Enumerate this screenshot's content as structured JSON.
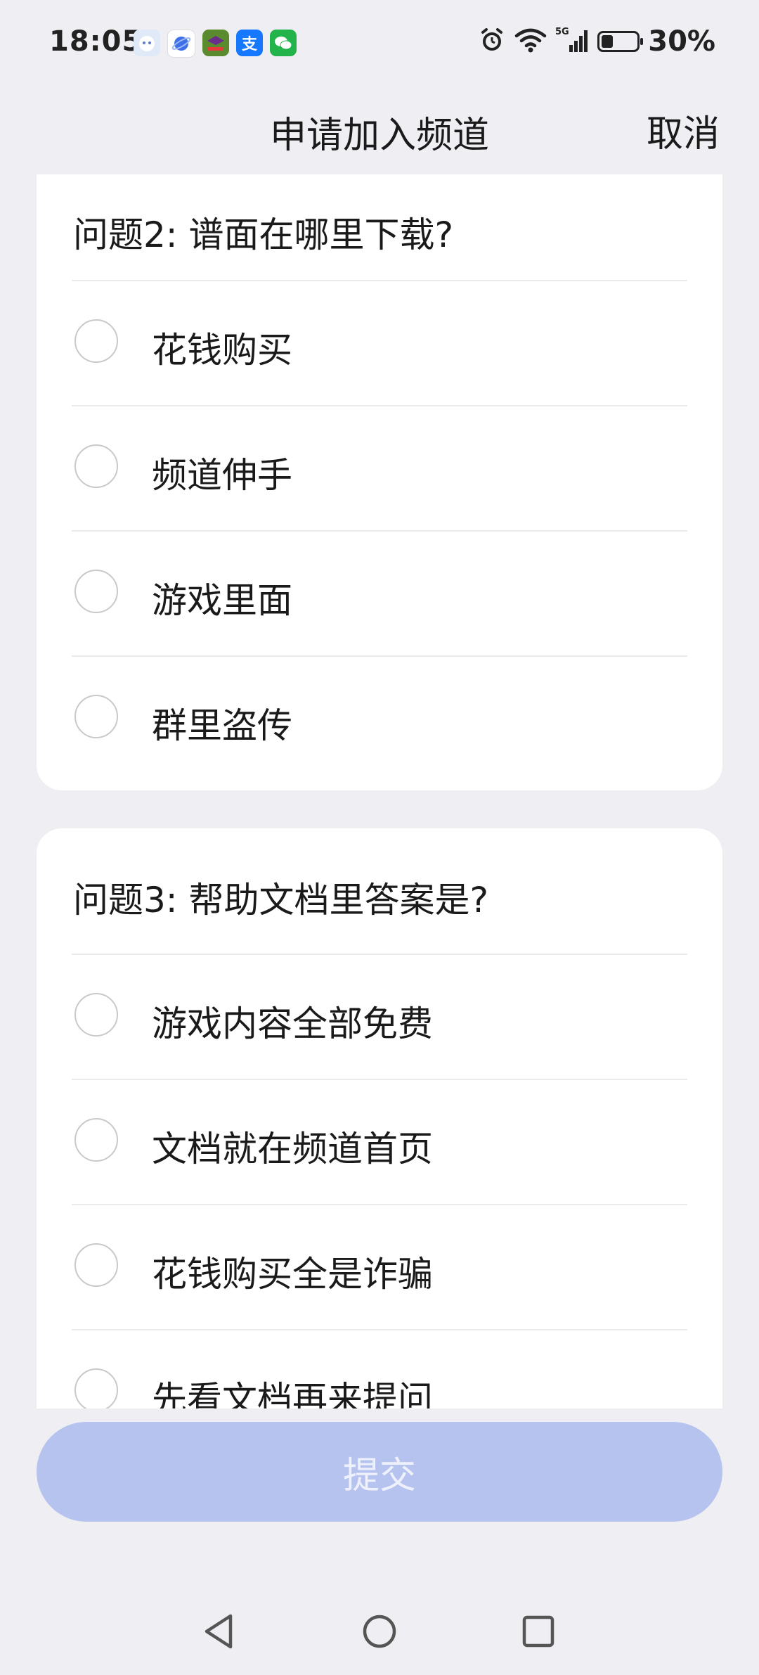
{
  "status_bar": {
    "time": "18:05",
    "battery_percent": "30%",
    "battery_level": 0.3,
    "network": "5G",
    "notification_icons": [
      "assistant-icon",
      "browser-icon",
      "game-app-icon",
      "alipay-icon",
      "wechat-icon"
    ],
    "alipay_glyph": "支"
  },
  "header": {
    "title": "申请加入频道",
    "cancel_label": "取消"
  },
  "questions": [
    {
      "title": "问题2: 谱面在哪里下载?",
      "options": [
        "花钱购买",
        "频道伸手",
        "游戏里面",
        "群里盗传"
      ]
    },
    {
      "title": "问题3: 帮助文档里答案是?",
      "options": [
        "游戏内容全部免费",
        "文档就在频道首页",
        "花钱购买全是诈骗",
        "先看文档再来提问"
      ]
    }
  ],
  "submit_label": "提交",
  "colors": {
    "background": "#EFEFF3",
    "card": "#FFFFFF",
    "submit_disabled": "#B6C3EF",
    "radio_border": "#C9C9C9"
  },
  "nav": {
    "icons": [
      "back-icon",
      "home-icon",
      "recents-icon"
    ]
  }
}
